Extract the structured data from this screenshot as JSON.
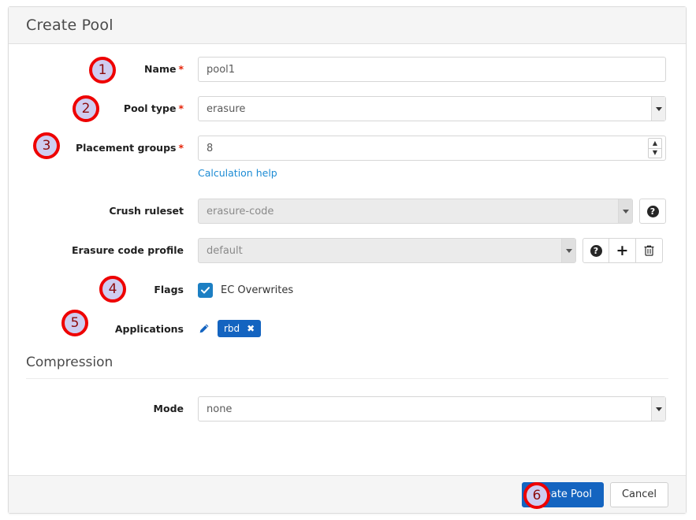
{
  "dialog": {
    "title": "Create Pool"
  },
  "form": {
    "name": {
      "label": "Name",
      "required_mark": "*",
      "value": "pool1"
    },
    "pool_type": {
      "label": "Pool type",
      "required_mark": "*",
      "value": "erasure"
    },
    "placement_groups": {
      "label": "Placement groups",
      "required_mark": "*",
      "value": "8",
      "help_link": "Calculation help"
    },
    "crush_ruleset": {
      "label": "Crush ruleset",
      "value": "erasure-code",
      "help_icon": "question-circle-icon"
    },
    "erasure_code_profile": {
      "label": "Erasure code profile",
      "value": "default",
      "help_icon": "question-circle-icon",
      "add_icon": "plus-icon",
      "delete_icon": "trash-icon"
    },
    "flags": {
      "label": "Flags",
      "checkbox_label": "EC Overwrites",
      "checked": true
    },
    "applications": {
      "label": "Applications",
      "edit_icon": "pencil-icon",
      "tags": [
        {
          "label": "rbd",
          "remove": "✖"
        }
      ]
    }
  },
  "compression": {
    "section_title": "Compression",
    "mode": {
      "label": "Mode",
      "value": "none"
    }
  },
  "footer": {
    "submit_label": "Create Pool",
    "cancel_label": "Cancel"
  },
  "annotations": [
    {
      "id": 1,
      "number": "1"
    },
    {
      "id": 2,
      "number": "2"
    },
    {
      "id": 3,
      "number": "3"
    },
    {
      "id": 4,
      "number": "4"
    },
    {
      "id": 5,
      "number": "5"
    },
    {
      "id": 6,
      "number": "6"
    }
  ],
  "colors": {
    "primary": "#1464c0",
    "link": "#1c8bd4",
    "required": "#e52207",
    "annotation_ring": "#ee0000",
    "annotation_fill": "#cfcdf0",
    "annotation_text": "#8b0b0b",
    "checkbox": "#1c7fc3",
    "header_bg": "#f5f5f5",
    "disabled_bg": "#ebebeb"
  }
}
